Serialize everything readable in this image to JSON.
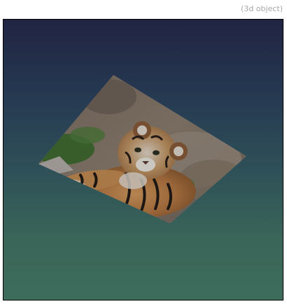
{
  "caption": "(3d object)",
  "scene": {
    "background_top": "#202442",
    "background_bottom": "#3e6d5c",
    "object": "tiger-photo-textured-plane"
  }
}
